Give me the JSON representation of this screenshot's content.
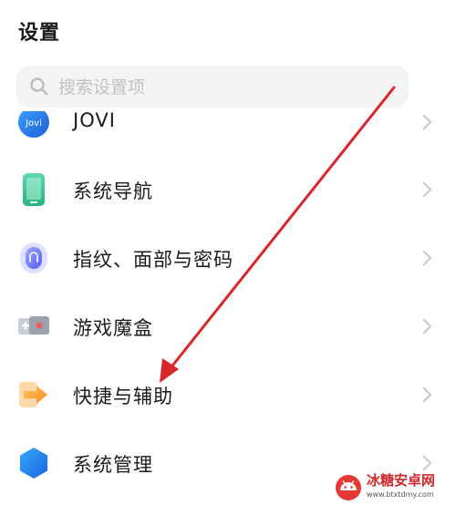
{
  "header": {
    "title": "设置"
  },
  "search": {
    "placeholder": "搜索设置项",
    "value": ""
  },
  "items": [
    {
      "label": "JOVI",
      "icon": "jovi-icon",
      "icon_text": "Jovi"
    },
    {
      "label": "系统导航",
      "icon": "phone-navigation-icon"
    },
    {
      "label": "指纹、面部与密码",
      "icon": "fingerprint-icon"
    },
    {
      "label": "游戏魔盒",
      "icon": "game-box-icon"
    },
    {
      "label": "快捷与辅助",
      "icon": "shortcut-arrow-icon"
    },
    {
      "label": "系统管理",
      "icon": "system-management-icon"
    }
  ],
  "annotation": {
    "icon": "red-arrow-pointer",
    "color": "#d9262a"
  },
  "watermark": {
    "title": "冰糖安卓网",
    "url": "www.btxtdmy.com",
    "icon": "android-logo-icon"
  },
  "colors": {
    "chevron": "#c8c8c8",
    "search_bg": "#f4f4f4",
    "placeholder": "#c2c2c2",
    "accent_red": "#d9262a"
  }
}
